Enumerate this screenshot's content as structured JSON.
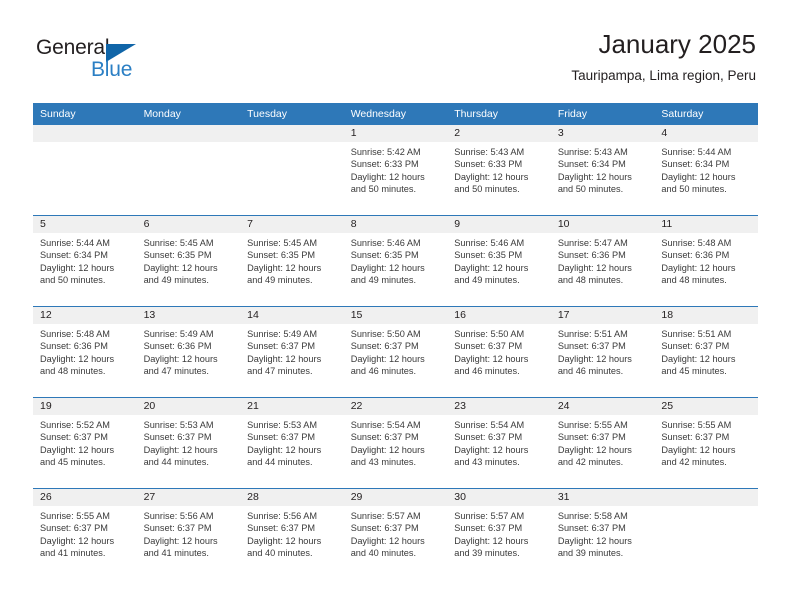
{
  "brand": {
    "name_part1": "General",
    "name_part2": "Blue"
  },
  "header": {
    "title": "January 2025",
    "location": "Tauripampa, Lima region, Peru"
  },
  "colors": {
    "header_blue": "#2e78b8",
    "brand_blue": "#2b7fc4",
    "daynum_band": "#f0f0f0",
    "text": "#231f20"
  },
  "weekday_headers": [
    "Sunday",
    "Monday",
    "Tuesday",
    "Wednesday",
    "Thursday",
    "Friday",
    "Saturday"
  ],
  "weeks": [
    [
      {
        "day": "",
        "empty": true
      },
      {
        "day": "",
        "empty": true
      },
      {
        "day": "",
        "empty": true
      },
      {
        "day": "1",
        "sunrise": "Sunrise: 5:42 AM",
        "sunset": "Sunset: 6:33 PM",
        "daylight_line1": "Daylight: 12 hours",
        "daylight_line2": "and 50 minutes."
      },
      {
        "day": "2",
        "sunrise": "Sunrise: 5:43 AM",
        "sunset": "Sunset: 6:33 PM",
        "daylight_line1": "Daylight: 12 hours",
        "daylight_line2": "and 50 minutes."
      },
      {
        "day": "3",
        "sunrise": "Sunrise: 5:43 AM",
        "sunset": "Sunset: 6:34 PM",
        "daylight_line1": "Daylight: 12 hours",
        "daylight_line2": "and 50 minutes."
      },
      {
        "day": "4",
        "sunrise": "Sunrise: 5:44 AM",
        "sunset": "Sunset: 6:34 PM",
        "daylight_line1": "Daylight: 12 hours",
        "daylight_line2": "and 50 minutes."
      }
    ],
    [
      {
        "day": "5",
        "sunrise": "Sunrise: 5:44 AM",
        "sunset": "Sunset: 6:34 PM",
        "daylight_line1": "Daylight: 12 hours",
        "daylight_line2": "and 50 minutes."
      },
      {
        "day": "6",
        "sunrise": "Sunrise: 5:45 AM",
        "sunset": "Sunset: 6:35 PM",
        "daylight_line1": "Daylight: 12 hours",
        "daylight_line2": "and 49 minutes."
      },
      {
        "day": "7",
        "sunrise": "Sunrise: 5:45 AM",
        "sunset": "Sunset: 6:35 PM",
        "daylight_line1": "Daylight: 12 hours",
        "daylight_line2": "and 49 minutes."
      },
      {
        "day": "8",
        "sunrise": "Sunrise: 5:46 AM",
        "sunset": "Sunset: 6:35 PM",
        "daylight_line1": "Daylight: 12 hours",
        "daylight_line2": "and 49 minutes."
      },
      {
        "day": "9",
        "sunrise": "Sunrise: 5:46 AM",
        "sunset": "Sunset: 6:35 PM",
        "daylight_line1": "Daylight: 12 hours",
        "daylight_line2": "and 49 minutes."
      },
      {
        "day": "10",
        "sunrise": "Sunrise: 5:47 AM",
        "sunset": "Sunset: 6:36 PM",
        "daylight_line1": "Daylight: 12 hours",
        "daylight_line2": "and 48 minutes."
      },
      {
        "day": "11",
        "sunrise": "Sunrise: 5:48 AM",
        "sunset": "Sunset: 6:36 PM",
        "daylight_line1": "Daylight: 12 hours",
        "daylight_line2": "and 48 minutes."
      }
    ],
    [
      {
        "day": "12",
        "sunrise": "Sunrise: 5:48 AM",
        "sunset": "Sunset: 6:36 PM",
        "daylight_line1": "Daylight: 12 hours",
        "daylight_line2": "and 48 minutes."
      },
      {
        "day": "13",
        "sunrise": "Sunrise: 5:49 AM",
        "sunset": "Sunset: 6:36 PM",
        "daylight_line1": "Daylight: 12 hours",
        "daylight_line2": "and 47 minutes."
      },
      {
        "day": "14",
        "sunrise": "Sunrise: 5:49 AM",
        "sunset": "Sunset: 6:37 PM",
        "daylight_line1": "Daylight: 12 hours",
        "daylight_line2": "and 47 minutes."
      },
      {
        "day": "15",
        "sunrise": "Sunrise: 5:50 AM",
        "sunset": "Sunset: 6:37 PM",
        "daylight_line1": "Daylight: 12 hours",
        "daylight_line2": "and 46 minutes."
      },
      {
        "day": "16",
        "sunrise": "Sunrise: 5:50 AM",
        "sunset": "Sunset: 6:37 PM",
        "daylight_line1": "Daylight: 12 hours",
        "daylight_line2": "and 46 minutes."
      },
      {
        "day": "17",
        "sunrise": "Sunrise: 5:51 AM",
        "sunset": "Sunset: 6:37 PM",
        "daylight_line1": "Daylight: 12 hours",
        "daylight_line2": "and 46 minutes."
      },
      {
        "day": "18",
        "sunrise": "Sunrise: 5:51 AM",
        "sunset": "Sunset: 6:37 PM",
        "daylight_line1": "Daylight: 12 hours",
        "daylight_line2": "and 45 minutes."
      }
    ],
    [
      {
        "day": "19",
        "sunrise": "Sunrise: 5:52 AM",
        "sunset": "Sunset: 6:37 PM",
        "daylight_line1": "Daylight: 12 hours",
        "daylight_line2": "and 45 minutes."
      },
      {
        "day": "20",
        "sunrise": "Sunrise: 5:53 AM",
        "sunset": "Sunset: 6:37 PM",
        "daylight_line1": "Daylight: 12 hours",
        "daylight_line2": "and 44 minutes."
      },
      {
        "day": "21",
        "sunrise": "Sunrise: 5:53 AM",
        "sunset": "Sunset: 6:37 PM",
        "daylight_line1": "Daylight: 12 hours",
        "daylight_line2": "and 44 minutes."
      },
      {
        "day": "22",
        "sunrise": "Sunrise: 5:54 AM",
        "sunset": "Sunset: 6:37 PM",
        "daylight_line1": "Daylight: 12 hours",
        "daylight_line2": "and 43 minutes."
      },
      {
        "day": "23",
        "sunrise": "Sunrise: 5:54 AM",
        "sunset": "Sunset: 6:37 PM",
        "daylight_line1": "Daylight: 12 hours",
        "daylight_line2": "and 43 minutes."
      },
      {
        "day": "24",
        "sunrise": "Sunrise: 5:55 AM",
        "sunset": "Sunset: 6:37 PM",
        "daylight_line1": "Daylight: 12 hours",
        "daylight_line2": "and 42 minutes."
      },
      {
        "day": "25",
        "sunrise": "Sunrise: 5:55 AM",
        "sunset": "Sunset: 6:37 PM",
        "daylight_line1": "Daylight: 12 hours",
        "daylight_line2": "and 42 minutes."
      }
    ],
    [
      {
        "day": "26",
        "sunrise": "Sunrise: 5:55 AM",
        "sunset": "Sunset: 6:37 PM",
        "daylight_line1": "Daylight: 12 hours",
        "daylight_line2": "and 41 minutes."
      },
      {
        "day": "27",
        "sunrise": "Sunrise: 5:56 AM",
        "sunset": "Sunset: 6:37 PM",
        "daylight_line1": "Daylight: 12 hours",
        "daylight_line2": "and 41 minutes."
      },
      {
        "day": "28",
        "sunrise": "Sunrise: 5:56 AM",
        "sunset": "Sunset: 6:37 PM",
        "daylight_line1": "Daylight: 12 hours",
        "daylight_line2": "and 40 minutes."
      },
      {
        "day": "29",
        "sunrise": "Sunrise: 5:57 AM",
        "sunset": "Sunset: 6:37 PM",
        "daylight_line1": "Daylight: 12 hours",
        "daylight_line2": "and 40 minutes."
      },
      {
        "day": "30",
        "sunrise": "Sunrise: 5:57 AM",
        "sunset": "Sunset: 6:37 PM",
        "daylight_line1": "Daylight: 12 hours",
        "daylight_line2": "and 39 minutes."
      },
      {
        "day": "31",
        "sunrise": "Sunrise: 5:58 AM",
        "sunset": "Sunset: 6:37 PM",
        "daylight_line1": "Daylight: 12 hours",
        "daylight_line2": "and 39 minutes."
      },
      {
        "day": "",
        "empty": true
      }
    ]
  ]
}
